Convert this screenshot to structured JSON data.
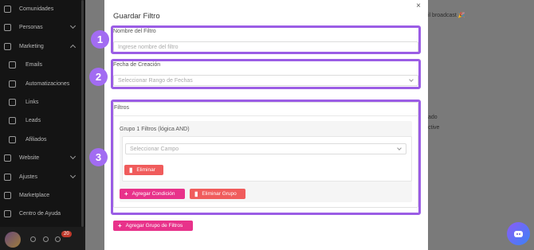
{
  "sidebar": {
    "items": [
      {
        "label": "Comunidades",
        "icon": "chat-icon",
        "child": false
      },
      {
        "label": "Personas",
        "icon": "users-icon",
        "child": false,
        "chevron": "down"
      },
      {
        "label": "Marketing",
        "icon": "megaphone-icon",
        "child": false,
        "chevron": "up"
      },
      {
        "label": "Emails",
        "icon": "mail-icon",
        "child": true
      },
      {
        "label": "Automatizaciones",
        "icon": "robot-icon",
        "child": true
      },
      {
        "label": "Links",
        "icon": "link-icon",
        "child": true
      },
      {
        "label": "Leads",
        "icon": "list-icon",
        "child": true
      },
      {
        "label": "Afiliados",
        "icon": "tag-icon",
        "child": true
      },
      {
        "label": "Website",
        "icon": "globe-icon",
        "child": false,
        "chevron": "down"
      },
      {
        "label": "Ajustes",
        "icon": "gear-icon",
        "child": false,
        "chevron": "down"
      },
      {
        "label": "Marketplace",
        "icon": "store-icon",
        "child": false
      },
      {
        "label": "Centro de Ayuda",
        "icon": "help-icon",
        "child": false
      }
    ],
    "notification_count": "20"
  },
  "background": {
    "broadcast_text": "il broadcast 🎉",
    "text_ado": "ado",
    "text_active": "ctive"
  },
  "modal": {
    "title": "Guardar Filtro",
    "close_icon": "×",
    "name_label": "Nombre del Filtro",
    "name_placeholder": "Ingrese nombre del filtro",
    "date_label": "Fecha de Creación",
    "date_placeholder": "Seleccionar Rango de Fechas",
    "filters_label": "Filtros",
    "group_title": "Grupo 1 Filtros (lógica AND)",
    "field_placeholder": "Seleccionar Campo",
    "delete_label": "Eliminar",
    "add_condition_label": "Agregar Condición",
    "delete_group_label": "Eliminar Grupo",
    "add_group_label": "Agregar Grupo de Filtros"
  },
  "annotations": [
    "1",
    "2",
    "3"
  ],
  "colors": {
    "annotation": "#9b5de5",
    "primary_pink": "#e8328a",
    "danger_red": "#f05c5c"
  }
}
